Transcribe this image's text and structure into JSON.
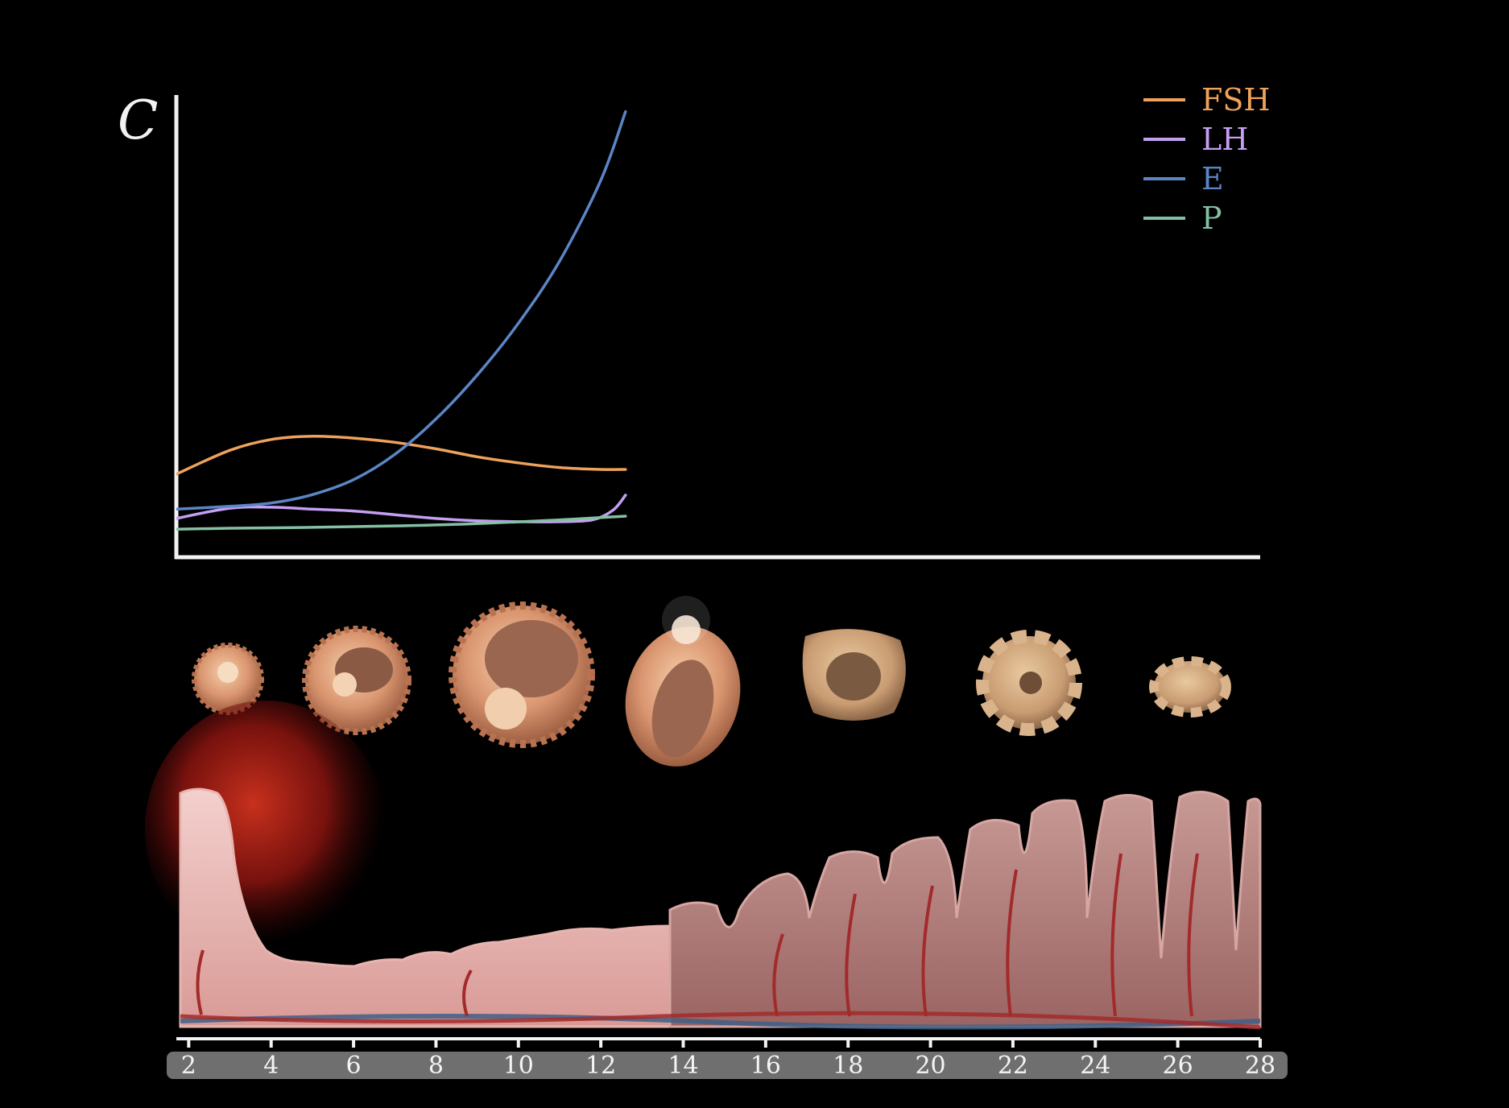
{
  "chart_data": {
    "type": "line",
    "ylabel": "C",
    "xlabel": "",
    "title": "",
    "xlim": [
      1.7,
      28
    ],
    "ylim": [
      0,
      100
    ],
    "x_ticks": [
      "2",
      "4",
      "6",
      "8",
      "10",
      "12",
      "14",
      "16",
      "18",
      "20",
      "22",
      "24",
      "26",
      "28"
    ],
    "legend_position": "top-right",
    "grid": false,
    "series": [
      {
        "name": "FSH",
        "color": "#eea25c",
        "x": [
          1.7,
          3,
          4,
          5,
          6,
          7,
          8,
          9,
          10,
          11,
          12,
          12.6
        ],
        "y": [
          17.8,
          22.9,
          25.2,
          25.9,
          25.5,
          24.6,
          23.2,
          21.5,
          20.2,
          19.2,
          18.8,
          18.8
        ]
      },
      {
        "name": "LH",
        "color": "#c59ff2",
        "x": [
          1.7,
          3,
          4,
          5,
          6,
          7,
          8,
          9,
          10,
          11,
          11.8,
          12.3,
          12.6
        ],
        "y": [
          8.3,
          10.5,
          10.7,
          10.3,
          9.9,
          9.1,
          8.3,
          7.8,
          7.6,
          7.6,
          8.0,
          10.1,
          13.3
        ]
      },
      {
        "name": "E",
        "color": "#5b86c6",
        "x": [
          1.7,
          3,
          4,
          5,
          6,
          7,
          8,
          9,
          10,
          11,
          12,
          12.6
        ],
        "y": [
          10.3,
          10.9,
          11.6,
          13.4,
          16.6,
          22.0,
          29.6,
          39.0,
          50.1,
          63.4,
          80.7,
          95.4
        ]
      },
      {
        "name": "P",
        "color": "#84c0a4",
        "x": [
          1.7,
          3,
          5,
          7,
          9,
          11,
          12.6
        ],
        "y": [
          6.0,
          6.2,
          6.4,
          6.7,
          7.2,
          8.0,
          8.8
        ]
      }
    ]
  }
}
